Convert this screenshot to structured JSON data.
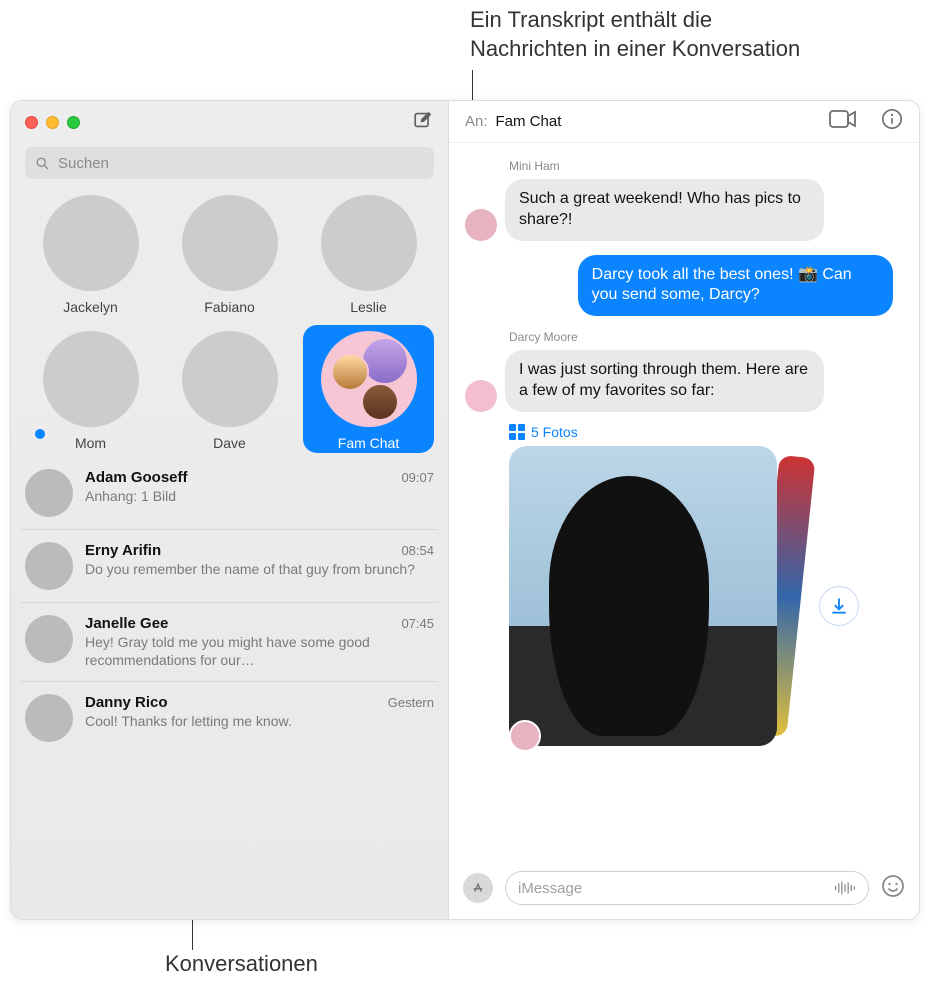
{
  "callouts": {
    "transcript": "Ein Transkript enthält die\nNachrichten in einer Konversation",
    "conversations": "Konversationen"
  },
  "sidebar": {
    "search_placeholder": "Suchen",
    "pins": [
      {
        "name": "Jackelyn",
        "selected": false,
        "unread": false
      },
      {
        "name": "Fabiano",
        "selected": false,
        "unread": false
      },
      {
        "name": "Leslie",
        "selected": false,
        "unread": false
      },
      {
        "name": "Mom",
        "selected": false,
        "unread": true
      },
      {
        "name": "Dave",
        "selected": false,
        "unread": false
      },
      {
        "name": "Fam Chat",
        "selected": true,
        "unread": false,
        "group": true
      }
    ],
    "conversations": [
      {
        "name": "Adam Gooseff",
        "time": "09:07",
        "preview": "Anhang: 1 Bild"
      },
      {
        "name": "Erny Arifin",
        "time": "08:54",
        "preview": "Do you remember the name of that guy from brunch?"
      },
      {
        "name": "Janelle Gee",
        "time": "07:45",
        "preview": "Hey! Gray told me you might have some good recommendations for our…"
      },
      {
        "name": "Danny Rico",
        "time": "Gestern",
        "preview": "Cool! Thanks for letting me know."
      }
    ]
  },
  "header": {
    "to_label": "An:",
    "to_value": "Fam Chat"
  },
  "messages": {
    "m1_sender": "Mini Ham",
    "m1_text": "Such a great weekend! Who has pics to share?!",
    "m2_text": "Darcy took all the best ones! 📸 Can you send some, Darcy?",
    "m3_sender": "Darcy Moore",
    "m3_text": "I was just sorting through them. Here are a few of my favorites so far:",
    "photos_label": "5 Fotos"
  },
  "composer": {
    "placeholder": "iMessage"
  }
}
